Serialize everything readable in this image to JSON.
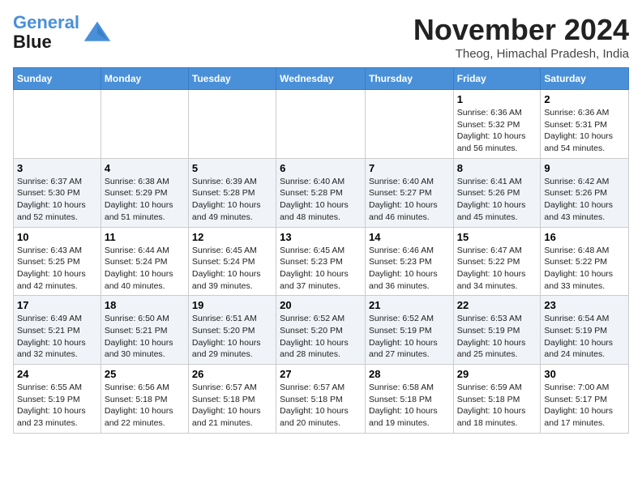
{
  "header": {
    "logo_line1": "General",
    "logo_line2": "Blue",
    "month_title": "November 2024",
    "location": "Theog, Himachal Pradesh, India"
  },
  "weekdays": [
    "Sunday",
    "Monday",
    "Tuesday",
    "Wednesday",
    "Thursday",
    "Friday",
    "Saturday"
  ],
  "weeks": [
    [
      {
        "day": "",
        "info": ""
      },
      {
        "day": "",
        "info": ""
      },
      {
        "day": "",
        "info": ""
      },
      {
        "day": "",
        "info": ""
      },
      {
        "day": "",
        "info": ""
      },
      {
        "day": "1",
        "info": "Sunrise: 6:36 AM\nSunset: 5:32 PM\nDaylight: 10 hours and 56 minutes."
      },
      {
        "day": "2",
        "info": "Sunrise: 6:36 AM\nSunset: 5:31 PM\nDaylight: 10 hours and 54 minutes."
      }
    ],
    [
      {
        "day": "3",
        "info": "Sunrise: 6:37 AM\nSunset: 5:30 PM\nDaylight: 10 hours and 52 minutes."
      },
      {
        "day": "4",
        "info": "Sunrise: 6:38 AM\nSunset: 5:29 PM\nDaylight: 10 hours and 51 minutes."
      },
      {
        "day": "5",
        "info": "Sunrise: 6:39 AM\nSunset: 5:28 PM\nDaylight: 10 hours and 49 minutes."
      },
      {
        "day": "6",
        "info": "Sunrise: 6:40 AM\nSunset: 5:28 PM\nDaylight: 10 hours and 48 minutes."
      },
      {
        "day": "7",
        "info": "Sunrise: 6:40 AM\nSunset: 5:27 PM\nDaylight: 10 hours and 46 minutes."
      },
      {
        "day": "8",
        "info": "Sunrise: 6:41 AM\nSunset: 5:26 PM\nDaylight: 10 hours and 45 minutes."
      },
      {
        "day": "9",
        "info": "Sunrise: 6:42 AM\nSunset: 5:26 PM\nDaylight: 10 hours and 43 minutes."
      }
    ],
    [
      {
        "day": "10",
        "info": "Sunrise: 6:43 AM\nSunset: 5:25 PM\nDaylight: 10 hours and 42 minutes."
      },
      {
        "day": "11",
        "info": "Sunrise: 6:44 AM\nSunset: 5:24 PM\nDaylight: 10 hours and 40 minutes."
      },
      {
        "day": "12",
        "info": "Sunrise: 6:45 AM\nSunset: 5:24 PM\nDaylight: 10 hours and 39 minutes."
      },
      {
        "day": "13",
        "info": "Sunrise: 6:45 AM\nSunset: 5:23 PM\nDaylight: 10 hours and 37 minutes."
      },
      {
        "day": "14",
        "info": "Sunrise: 6:46 AM\nSunset: 5:23 PM\nDaylight: 10 hours and 36 minutes."
      },
      {
        "day": "15",
        "info": "Sunrise: 6:47 AM\nSunset: 5:22 PM\nDaylight: 10 hours and 34 minutes."
      },
      {
        "day": "16",
        "info": "Sunrise: 6:48 AM\nSunset: 5:22 PM\nDaylight: 10 hours and 33 minutes."
      }
    ],
    [
      {
        "day": "17",
        "info": "Sunrise: 6:49 AM\nSunset: 5:21 PM\nDaylight: 10 hours and 32 minutes."
      },
      {
        "day": "18",
        "info": "Sunrise: 6:50 AM\nSunset: 5:21 PM\nDaylight: 10 hours and 30 minutes."
      },
      {
        "day": "19",
        "info": "Sunrise: 6:51 AM\nSunset: 5:20 PM\nDaylight: 10 hours and 29 minutes."
      },
      {
        "day": "20",
        "info": "Sunrise: 6:52 AM\nSunset: 5:20 PM\nDaylight: 10 hours and 28 minutes."
      },
      {
        "day": "21",
        "info": "Sunrise: 6:52 AM\nSunset: 5:19 PM\nDaylight: 10 hours and 27 minutes."
      },
      {
        "day": "22",
        "info": "Sunrise: 6:53 AM\nSunset: 5:19 PM\nDaylight: 10 hours and 25 minutes."
      },
      {
        "day": "23",
        "info": "Sunrise: 6:54 AM\nSunset: 5:19 PM\nDaylight: 10 hours and 24 minutes."
      }
    ],
    [
      {
        "day": "24",
        "info": "Sunrise: 6:55 AM\nSunset: 5:19 PM\nDaylight: 10 hours and 23 minutes."
      },
      {
        "day": "25",
        "info": "Sunrise: 6:56 AM\nSunset: 5:18 PM\nDaylight: 10 hours and 22 minutes."
      },
      {
        "day": "26",
        "info": "Sunrise: 6:57 AM\nSunset: 5:18 PM\nDaylight: 10 hours and 21 minutes."
      },
      {
        "day": "27",
        "info": "Sunrise: 6:57 AM\nSunset: 5:18 PM\nDaylight: 10 hours and 20 minutes."
      },
      {
        "day": "28",
        "info": "Sunrise: 6:58 AM\nSunset: 5:18 PM\nDaylight: 10 hours and 19 minutes."
      },
      {
        "day": "29",
        "info": "Sunrise: 6:59 AM\nSunset: 5:18 PM\nDaylight: 10 hours and 18 minutes."
      },
      {
        "day": "30",
        "info": "Sunrise: 7:00 AM\nSunset: 5:17 PM\nDaylight: 10 hours and 17 minutes."
      }
    ]
  ]
}
